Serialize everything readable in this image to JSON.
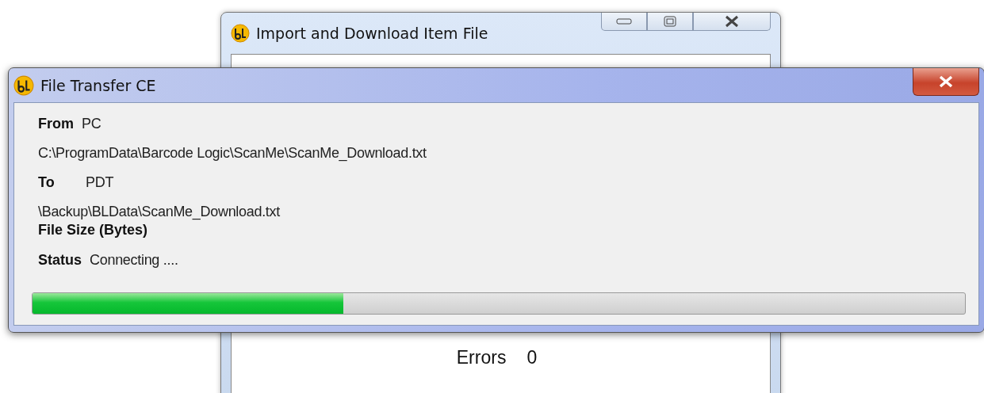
{
  "back_window": {
    "title": "Import and Download Item File",
    "errors": {
      "label": "Errors",
      "value": "0"
    }
  },
  "transfer_window": {
    "title": "File Transfer CE",
    "rows": [
      {
        "kind": "pair",
        "label": "From",
        "value": "PC"
      },
      {
        "kind": "path",
        "value": "C:\\ProgramData\\Barcode Logic\\ScanMe\\ScanMe_Download.txt"
      },
      {
        "kind": "pair",
        "label": "To",
        "value": "PDT"
      },
      {
        "kind": "path",
        "value": "\\Backup\\BLData\\ScanMe_Download.txt"
      },
      {
        "kind": "label",
        "label": "File Size (Bytes)"
      },
      {
        "kind": "pair",
        "label": "Status",
        "value": "Connecting ...."
      }
    ],
    "progress": {
      "level": 0.333
    }
  }
}
